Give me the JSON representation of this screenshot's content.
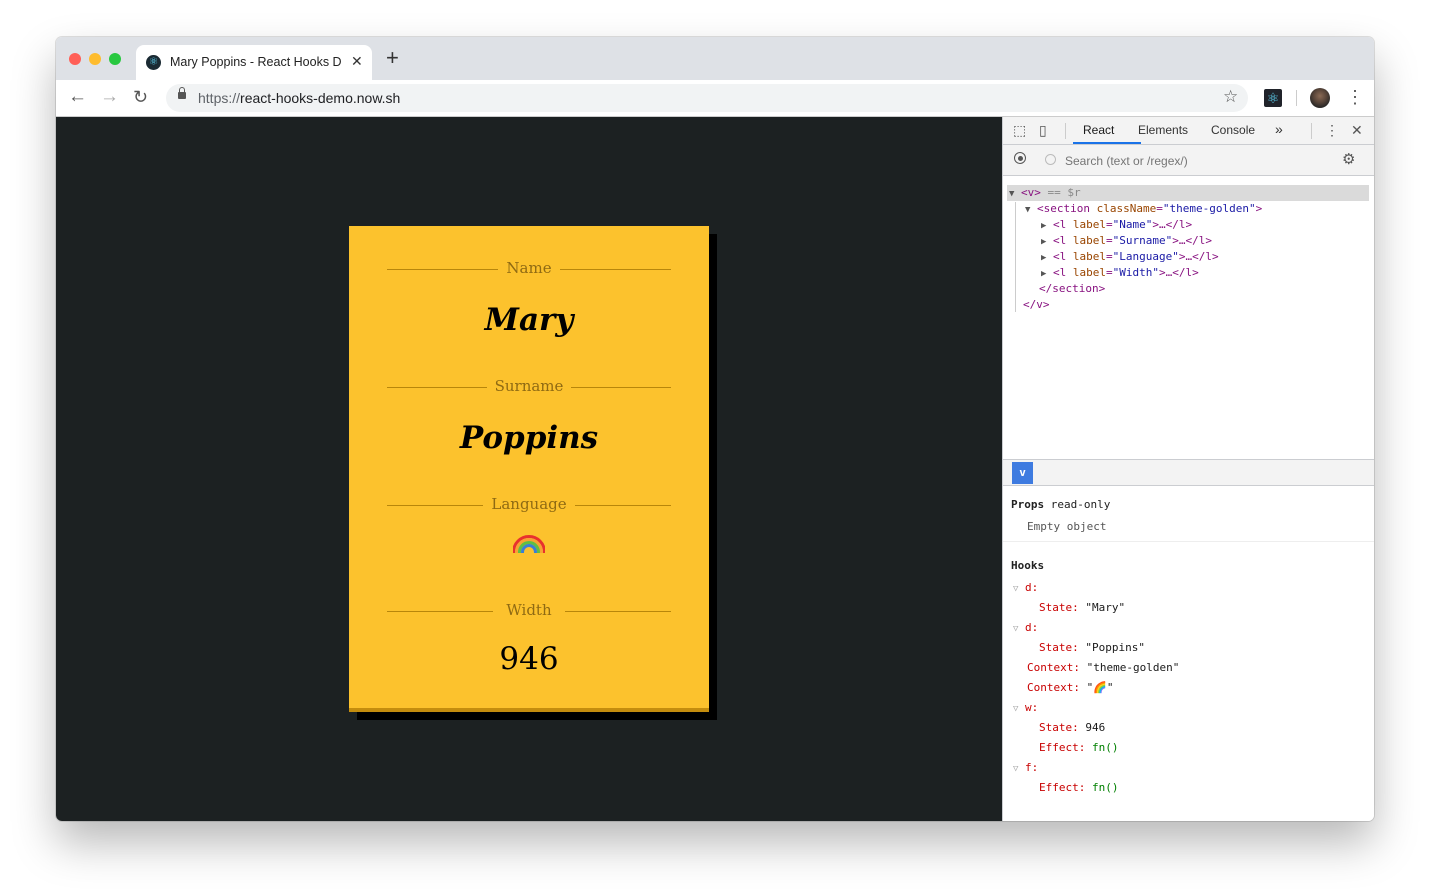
{
  "browser": {
    "tab_title": "Mary Poppins - React Hooks Demo",
    "url_scheme": "https://",
    "url_host": "react-hooks-demo.now.sh",
    "icons": [
      "close-icon",
      "new-tab-icon",
      "back-icon",
      "forward-icon",
      "reload-icon",
      "lock-icon",
      "star-icon",
      "react-extension-icon",
      "avatar",
      "menu-icon"
    ]
  },
  "card": {
    "theme_color": "#fcc22d",
    "fields": [
      {
        "label": "Name",
        "value": "Mary"
      },
      {
        "label": "Surname",
        "value": "Poppins"
      },
      {
        "label": "Language",
        "value": "🌈"
      },
      {
        "label": "Width",
        "value": "946"
      }
    ]
  },
  "devtools": {
    "tabs": [
      "React",
      "Elements",
      "Console",
      "»"
    ],
    "active_tab": "React",
    "search_placeholder": "Search (text or /regex/)",
    "tree": {
      "root_open": "<v>",
      "root_suffix": " == $r",
      "section_open_tag": "<section",
      "section_attr_name": "className",
      "section_attr_value": "\"theme-golden\"",
      "children": [
        {
          "tag": "<l",
          "attr": "label",
          "value": "\"Name\"",
          "tail": ">…</l>"
        },
        {
          "tag": "<l",
          "attr": "label",
          "value": "\"Surname\"",
          "tail": ">…</l>"
        },
        {
          "tag": "<l",
          "attr": "label",
          "value": "\"Language\"",
          "tail": ">…</l>"
        },
        {
          "tag": "<l",
          "attr": "label",
          "value": "\"Width\"",
          "tail": ">…</l>"
        }
      ],
      "section_close": "</section>",
      "root_close": "</v>"
    },
    "selected_badge": "v",
    "props": {
      "heading": "Props",
      "note": "read-only",
      "empty": "Empty object"
    },
    "hooks": {
      "heading": "Hooks",
      "items": [
        {
          "k": "d:",
          "type": "group"
        },
        {
          "k": "State:",
          "v": "\"Mary\"",
          "type": "sub"
        },
        {
          "k": "d:",
          "type": "group"
        },
        {
          "k": "State:",
          "v": "\"Poppins\"",
          "type": "sub"
        },
        {
          "k": "Context:",
          "v": "\"theme-golden\"",
          "type": "top"
        },
        {
          "k": "Context:",
          "v": "\"🌈\"",
          "type": "top"
        },
        {
          "k": "w:",
          "type": "group"
        },
        {
          "k": "State:",
          "v": "946",
          "type": "sub"
        },
        {
          "k": "Effect:",
          "v": "fn()",
          "type": "subfn"
        },
        {
          "k": "f:",
          "type": "group"
        },
        {
          "k": "Effect:",
          "v": "fn()",
          "type": "subfn"
        }
      ]
    }
  }
}
